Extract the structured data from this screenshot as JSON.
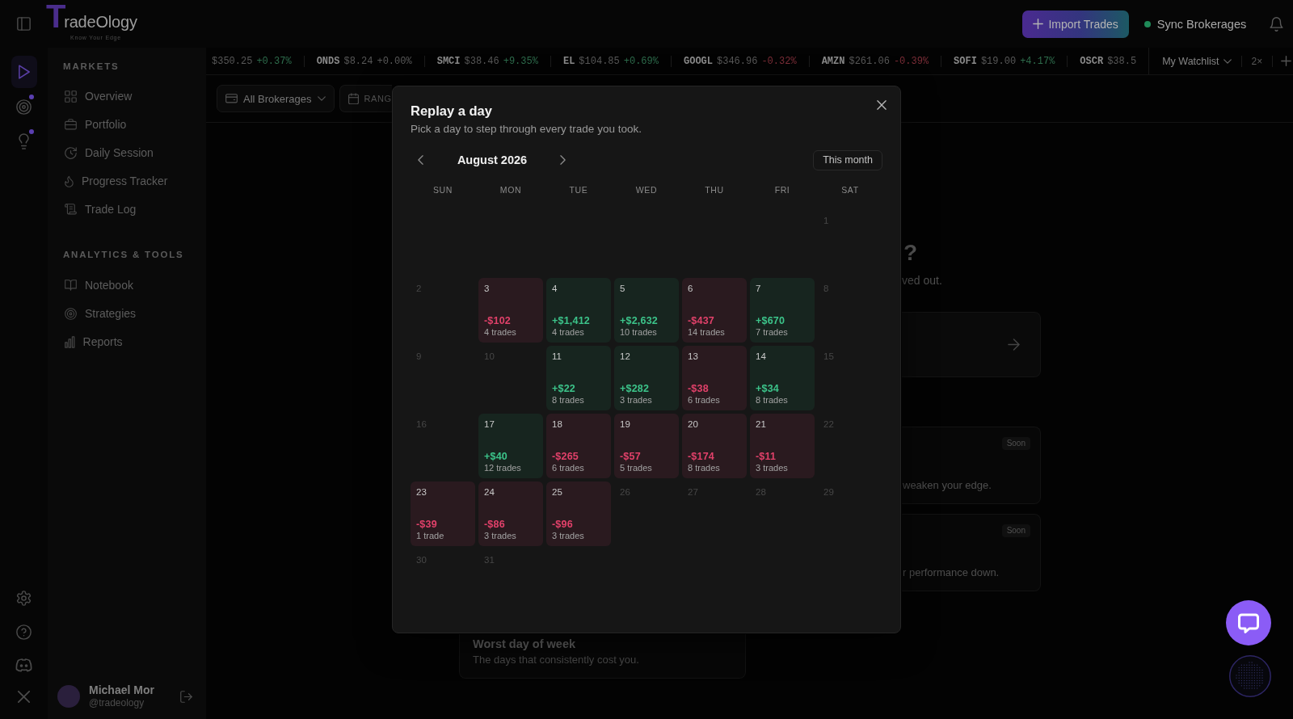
{
  "rail": {
    "items": [
      {
        "selected": true,
        "notify": false
      },
      {
        "selected": false,
        "notify": true
      },
      {
        "selected": false,
        "notify": true
      }
    ]
  },
  "logo": {
    "wordmark": "TradeOlogy",
    "tagline": "Know Your Edge"
  },
  "top_bar": {
    "import_button": "Import Trades",
    "sync": {
      "label": "Sync Brokerages",
      "connected": true
    }
  },
  "sidebar": {
    "sections": [
      {
        "title": "MARKETS",
        "items": [
          {
            "label": "Overview",
            "selected": false
          },
          {
            "label": "Portfolio",
            "selected": false
          },
          {
            "label": "Daily Session",
            "selected": false
          },
          {
            "label": "Progress Tracker",
            "selected": false
          },
          {
            "label": "Trade Log",
            "selected": false
          }
        ]
      },
      {
        "title": "ANALYTICS & TOOLS",
        "items": [
          {
            "label": "Notebook",
            "selected": false
          },
          {
            "label": "Strategies",
            "selected": false
          },
          {
            "label": "Reports",
            "selected": false
          }
        ]
      }
    ],
    "user": {
      "name": "Michael Mor",
      "handle": "@tradeology"
    }
  },
  "ticker": {
    "quotes": [
      {
        "price": "$350.25",
        "change": "+0.37%",
        "color": "#2e6c4c"
      },
      {
        "symbol": "ONDS",
        "price": "$8.24",
        "change": "+0.00%",
        "color": "#5a5a5a"
      },
      {
        "symbol": "SMCI",
        "price": "$38.46",
        "change": "+9.35%",
        "color": "#2e6c4c"
      },
      {
        "symbol": "EL",
        "price": "$104.85",
        "change": "+0.69%",
        "color": "#2e6c4c"
      },
      {
        "symbol": "GOOGL",
        "price": "$346.96",
        "change": "-0.32%",
        "color": "#7c2e38"
      },
      {
        "symbol": "AMZN",
        "price": "$261.06",
        "change": "-0.39%",
        "color": "#7c2e38"
      },
      {
        "symbol": "SOFI",
        "price": "$19.00",
        "change": "+4.17%",
        "color": "#2e6c4c"
      },
      {
        "symbol": "OSCR",
        "price": "$38.5"
      }
    ],
    "watchlist": "My Watchlist",
    "speed": "2×"
  },
  "filters": [
    {
      "label": "All Brokerages",
      "dropdown": true
    },
    {
      "label": "RANG",
      "dropdown": false
    }
  ],
  "background": {
    "heading": "?",
    "subheading": "ved out.",
    "cards": [
      {
        "badge": "Soon",
        "text": "weaken your edge."
      },
      {
        "badge": "Soon",
        "text": "r performance down."
      }
    ],
    "worst_day_card": {
      "title": "Worst day of week",
      "text": "The days that consistently cost you."
    }
  },
  "replay_modal": {
    "title": "Replay a day",
    "subtitle": "Pick a day to step through every trade you took.",
    "month": "August 2026",
    "this_month_button": "This month",
    "weekdays": [
      "SUN",
      "MON",
      "TUE",
      "WED",
      "THU",
      "FRI",
      "SAT"
    ],
    "weeks": [
      [
        {
          "day": "1"
        }
      ],
      [
        {
          "day": "2"
        },
        {
          "day": "3",
          "pnl": "-$102",
          "trade_count": "4 trades",
          "loss": true
        },
        {
          "day": "4",
          "pnl": "+$1,412",
          "trade_count": "4 trades",
          "loss": false
        },
        {
          "day": "5",
          "pnl": "+$2,632",
          "trade_count": "10 trades",
          "loss": false
        },
        {
          "day": "6",
          "pnl": "-$437",
          "trade_count": "14 trades",
          "loss": true
        },
        {
          "day": "7",
          "pnl": "+$670",
          "trade_count": "7 trades",
          "loss": false
        },
        {
          "day": "8"
        }
      ],
      [
        {
          "day": "9"
        },
        {
          "day": "10"
        },
        {
          "day": "11",
          "pnl": "+$22",
          "trade_count": "8 trades",
          "loss": false
        },
        {
          "day": "12",
          "pnl": "+$282",
          "trade_count": "3 trades",
          "loss": false
        },
        {
          "day": "13",
          "pnl": "-$38",
          "trade_count": "6 trades",
          "loss": true
        },
        {
          "day": "14",
          "pnl": "+$34",
          "trade_count": "8 trades",
          "loss": false
        },
        {
          "day": "15"
        }
      ],
      [
        {
          "day": "16"
        },
        {
          "day": "17",
          "pnl": "+$40",
          "trade_count": "12 trades",
          "loss": false
        },
        {
          "day": "18",
          "pnl": "-$265",
          "trade_count": "6 trades",
          "loss": true
        },
        {
          "day": "19",
          "pnl": "-$57",
          "trade_count": "5 trades",
          "loss": true
        },
        {
          "day": "20",
          "pnl": "-$174",
          "trade_count": "8 trades",
          "loss": true
        },
        {
          "day": "21",
          "pnl": "-$11",
          "trade_count": "3 trades",
          "loss": true
        },
        {
          "day": "22"
        }
      ],
      [
        {
          "day": "23",
          "pnl": "-$39",
          "trade_count": "1 trade",
          "loss": true
        },
        {
          "day": "24",
          "pnl": "-$86",
          "trade_count": "3 trades",
          "loss": true
        },
        {
          "day": "25",
          "pnl": "-$96",
          "trade_count": "3 trades",
          "loss": true
        },
        {
          "day": "26"
        },
        {
          "day": "27"
        },
        {
          "day": "28"
        },
        {
          "day": "29"
        }
      ],
      [
        {
          "day": "30"
        },
        {
          "day": "31"
        }
      ]
    ]
  }
}
